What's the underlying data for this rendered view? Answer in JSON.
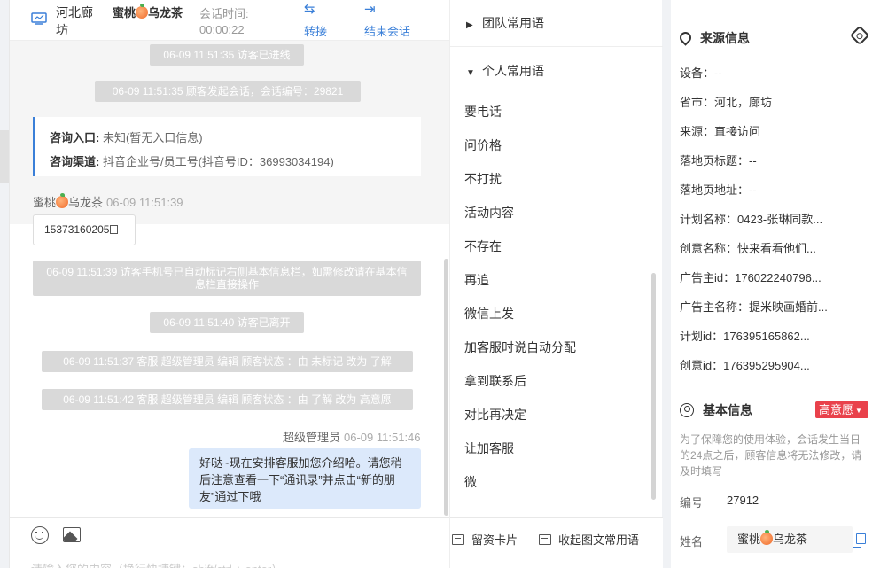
{
  "header": {
    "location": "河北廊坊",
    "visitor_name": "蜜桃",
    "visitor_name_suffix": "乌龙茶",
    "time_label": "会话时间:",
    "time_value": "00:00:22",
    "transfer_label": "转接",
    "end_label": "结束会话"
  },
  "messages": {
    "sys1": "06-09 11:51:35 访客已进线",
    "sys2": "06-09 11:51:35 顾客发起会话，会话编号：29821",
    "card_entry_label": "咨询入口:",
    "card_entry_value": "未知(暂无入口信息)",
    "card_channel_label": "咨询渠道:",
    "card_channel_value": "抖音企业号/员工号(抖音号ID：36993034194)",
    "visitor_sender": "蜜桃",
    "visitor_sender_suffix": "乌龙茶",
    "visitor_time": "06-09 11:51:39",
    "phone": "15373160205",
    "sys3": "06-09 11:51:39 访客手机号已自动标记右侧基本信息栏，如需修改请在基本信息栏直接操作",
    "sys4": "06-09 11:51:40 访客已离开",
    "sys5": "06-09 11:51:37 客服 超级管理员 编辑 顾客状态 ：由 未标记 改为 了解",
    "sys6": "06-09 11:51:42 客服 超级管理员 编辑 顾客状态 ：由 了解 改为 高意愿",
    "agent_sender": "超级管理员",
    "agent_time": "06-09 11:51:46",
    "agent_text": "好哒~现在安排客服加您介绍哈。请您稍后注意查看一下“通讯录”并点击“新的朋友”通过下哦"
  },
  "composer": {
    "emoji_icon": "emoji-icon",
    "image_icon": "image-icon",
    "placeholder": "请输入您的内容（换行快捷键：shift/ctrl + enter）"
  },
  "phrases": {
    "team_group": "团队常用语",
    "personal_group": "个人常用语",
    "items": [
      "要电话",
      "问价格",
      "不打扰",
      "活动内容",
      "不存在",
      "再追",
      "微信上发",
      "加客服时说自动分配",
      "拿到联系后",
      "对比再决定",
      "让加客服",
      "微"
    ],
    "footer_card": "留资卡片",
    "footer_collapse": "收起图文常用语"
  },
  "source": {
    "title": "来源信息",
    "rows": [
      "设备：--",
      "省市：河北，廊坊",
      "来源：直接访问",
      "落地页标题：--",
      "落地页地址：--",
      "计划名称：0423-张琳同款...",
      "创意名称：快来看看他们...",
      "广告主id：176022240796...",
      "广告主名称：提米映画婚前...",
      "计划id：176395165862...",
      "创意id：176395295904..."
    ]
  },
  "basic": {
    "title": "基本信息",
    "tag": "高意愿",
    "note": "为了保障您的使用体验，会话发生当日的24点之后，顾客信息将无法修改，请及时填写",
    "id_label": "编号",
    "id_value": "27912",
    "name_label": "姓名",
    "name_value": "蜜桃",
    "name_value_suffix": "乌龙茶"
  },
  "colors": {
    "accent": "#3a7fd8",
    "tag_red": "#e9414b",
    "bubble": "#dce9fb",
    "system_msg": "#d9d9d9"
  }
}
